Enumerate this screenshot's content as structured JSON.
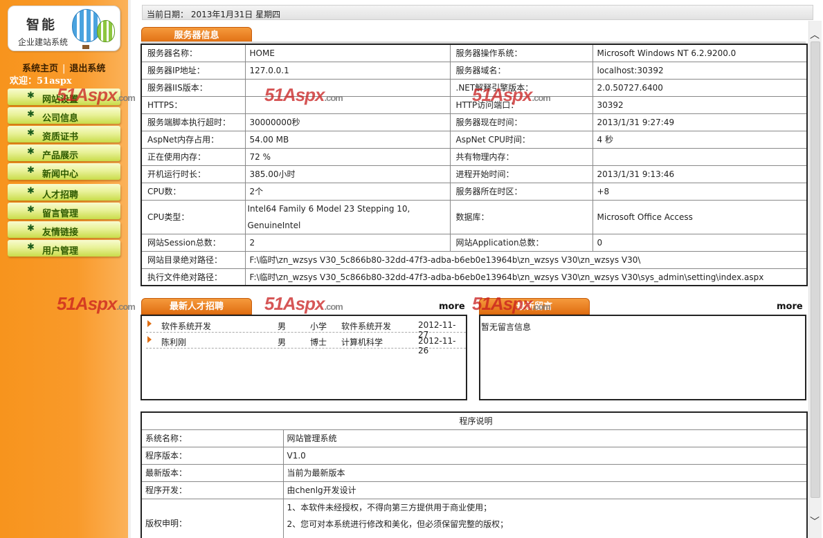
{
  "sidebar": {
    "logo_title": "智能",
    "logo_subtitle": "企业建站系统",
    "home_link": "系统主页",
    "separator": "|",
    "logout_link": "退出系统",
    "welcome": "欢迎：51aspx",
    "menu": [
      "网站设置",
      "公司信息",
      "资质证书",
      "产品展示",
      "新闻中心",
      "人才招聘",
      "留言管理",
      "友情链接",
      "用户管理"
    ]
  },
  "date_bar": "当前日期： 2013年1月31日 星期四",
  "server_info": {
    "title": "服务器信息",
    "rows": [
      [
        "服务器名称：",
        "HOME",
        "服务器操作系统：",
        "Microsoft Windows NT 6.2.9200.0"
      ],
      [
        "服务器IP地址：",
        "127.0.0.1",
        "服务器域名：",
        "localhost:30392"
      ],
      [
        "服务器IIS版本：",
        "",
        ".NET解释引擎版本：",
        "2.0.50727.6400"
      ],
      [
        "HTTPS：",
        "",
        "HTTP访问端口：",
        "30392"
      ],
      [
        "服务端脚本执行超时：",
        "30000000秒",
        "服务器现在时间：",
        "2013/1/31 9:27:49"
      ],
      [
        "AspNet内存占用：",
        "54.00 MB",
        "AspNet CPU时间：",
        "4 秒"
      ],
      [
        "正在使用内存：",
        "72 %",
        "共有物理内存：",
        ""
      ],
      [
        "开机运行时长：",
        "385.00小时",
        "进程开始时间：",
        "2013/1/31 9:13:46"
      ],
      [
        "CPU数：",
        "2个",
        "服务器所在时区：",
        "+8"
      ],
      [
        "CPU类型：",
        "Intel64 Family 6 Model 23 Stepping 10, GenuineIntel",
        "数据库：",
        "Microsoft Office Access"
      ],
      [
        "网站Session总数：",
        "2",
        "网站Application总数：",
        "0"
      ]
    ],
    "path_rows": [
      [
        "网站目录绝对路径：",
        "F:\\临时\\zn_wzsys V30_5c866b80-32dd-47f3-adba-b6eb0e13964b\\zn_wzsys V30\\zn_wzsys V30\\"
      ],
      [
        "执行文件绝对路径：",
        "F:\\临时\\zn_wzsys V30_5c866b80-32dd-47f3-adba-b6eb0e13964b\\zn_wzsys V30\\zn_wzsys V30\\sys_admin\\setting\\index.aspx"
      ]
    ]
  },
  "jobs": {
    "title": "最新人才招聘",
    "more": "more",
    "rows": [
      {
        "name": "软件系统开发",
        "gender": "男",
        "edu": "小学",
        "major": "软件系统开发",
        "date": "2012-11-27"
      },
      {
        "name": "陈利刚",
        "gender": "男",
        "edu": "博士",
        "major": "计算机科学",
        "date": "2012-11-26"
      }
    ]
  },
  "messages": {
    "title": "最新留言",
    "more": "more",
    "empty": "暂无留言信息"
  },
  "program": {
    "header": "程序说明",
    "rows": [
      [
        "系统名称：",
        "网站管理系统"
      ],
      [
        "程序版本：",
        "V1.0"
      ],
      [
        "最新版本：",
        "当前为最新版本"
      ],
      [
        "程序开发：",
        "由chenlg开发设计"
      ]
    ],
    "copyright_label": "版权申明：",
    "copyright_lines": [
      "1、本软件未经授权，不得向第三方提供用于商业使用；",
      "2、您可对本系统进行修改和美化，但必须保留完整的版权；"
    ]
  },
  "watermark": {
    "brand": "51Aspx",
    "suffix": ".com"
  },
  "scrollbar": {
    "up": "︿",
    "down": "﹀"
  }
}
